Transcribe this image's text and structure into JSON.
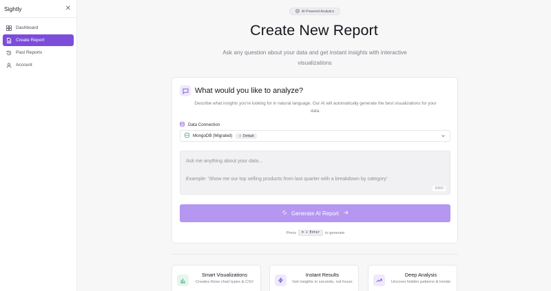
{
  "sidebar": {
    "brand": "Sightly",
    "close_icon": "close-icon",
    "items": [
      {
        "label": "Dashboard",
        "icon": "grid-icon",
        "active": false
      },
      {
        "label": "Create Report",
        "icon": "file-icon",
        "active": true
      },
      {
        "label": "Past Reports",
        "icon": "history-icon",
        "active": false
      },
      {
        "label": "Account",
        "icon": "user-icon",
        "active": false
      }
    ]
  },
  "header": {
    "pill": "AI-Powered Analytics",
    "title": "Create New Report",
    "subtitle": "Ask any question about your data and get instant insights with interactive visualizations"
  },
  "card": {
    "title": "What would you like to analyze?",
    "description": "Describe what insights you're looking for in natural language. Our AI will automatically generate the best visualizations for your data.",
    "data_connection": {
      "label": "Data Connection",
      "selected": "MongoDB (Migrated)",
      "badge": "Default"
    },
    "query": {
      "placeholder_line1": "Ask me anything about your data...",
      "placeholder_line2": "Example: 'Show me our top selling products from last quarter with a breakdown by category'",
      "count": "0/500"
    },
    "generate_button": "Generate AI Report",
    "hint_prefix": "Press",
    "hint_keys": "⌘ + Enter",
    "hint_suffix": "to generate"
  },
  "features": [
    {
      "title": "Smart Visualizations",
      "description": "Creates three chart types & CSV",
      "icon": "bar-chart-icon",
      "color": "#22a565",
      "bg": "#e6f6ee"
    },
    {
      "title": "Instant Results",
      "description": "Get insights in seconds, not hours",
      "icon": "lightning-icon",
      "color": "#6d4fd6",
      "bg": "#efe9fb"
    },
    {
      "title": "Deep Analysis",
      "description": "Uncover hidden patterns & trends",
      "icon": "trend-icon",
      "color": "#7c4ddb",
      "bg": "#efe9fb"
    }
  ],
  "colors": {
    "accent": "#7c4ddb",
    "button_disabled": "#b596f0"
  }
}
